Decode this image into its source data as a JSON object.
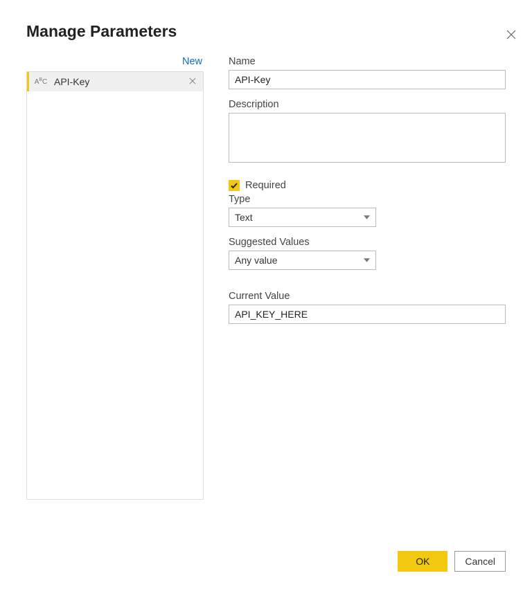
{
  "dialog": {
    "title": "Manage Parameters",
    "new_label": "New"
  },
  "sidebar": {
    "items": [
      {
        "name": "API-Key"
      }
    ]
  },
  "form": {
    "name_label": "Name",
    "name_value": "API-Key",
    "description_label": "Description",
    "description_value": "",
    "required_label": "Required",
    "required_checked": true,
    "type_label": "Type",
    "type_value": "Text",
    "suggested_label": "Suggested Values",
    "suggested_value": "Any value",
    "current_label": "Current Value",
    "current_value": "API_KEY_HERE"
  },
  "footer": {
    "ok_label": "OK",
    "cancel_label": "Cancel"
  }
}
